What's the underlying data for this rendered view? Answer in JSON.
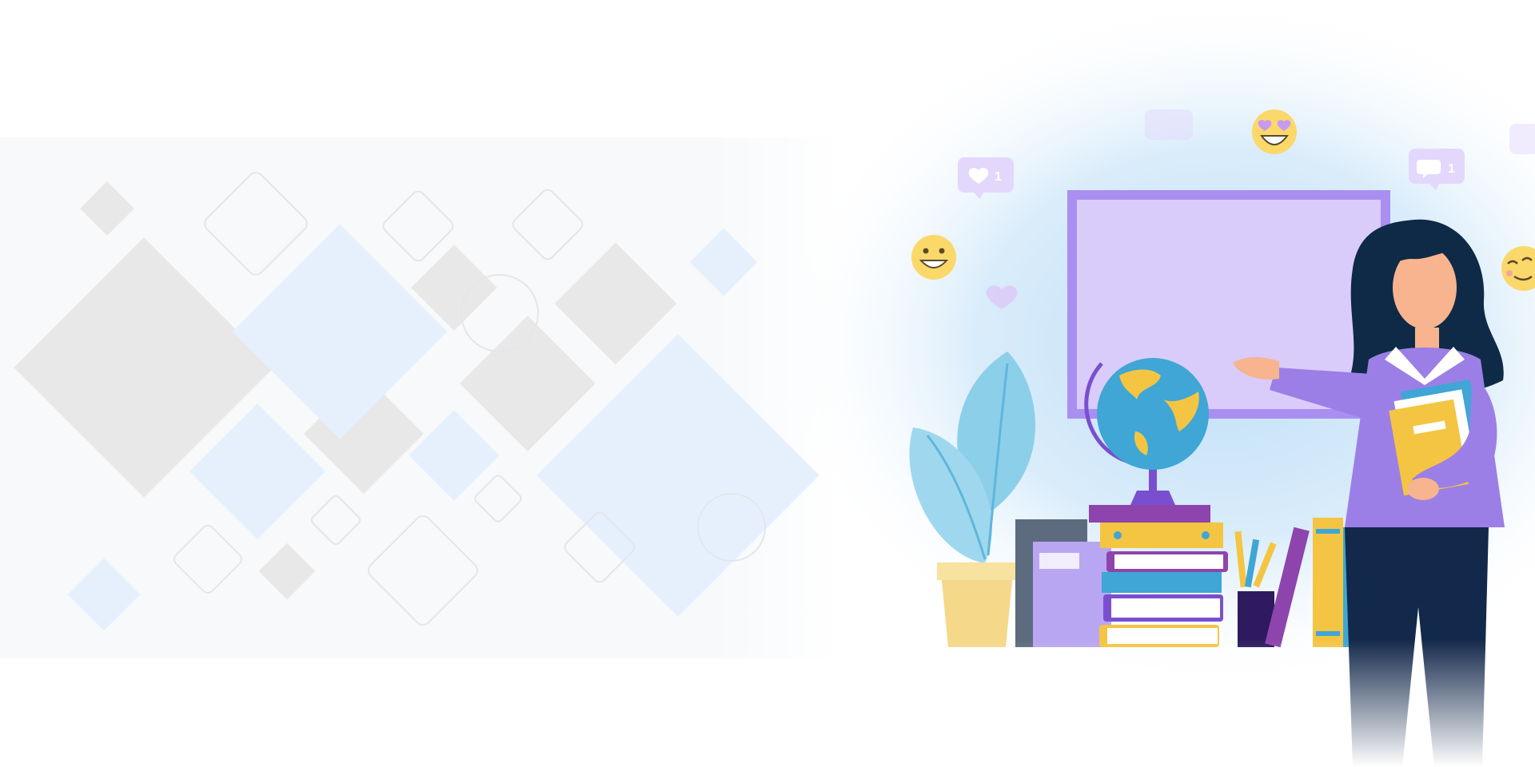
{
  "banner": {
    "reaction_counts": {
      "like": "1",
      "comment": "1"
    },
    "colors": {
      "background": "#ffffff",
      "panel": "#f7f9fb",
      "diamond_gray": "#e8e8e8",
      "diamond_blue": "#e6f0fd",
      "sky_glow": "#bfdff7",
      "board_frame": "#a98ff0",
      "board_fill": "#d9ccfb",
      "teacher_sweater": "#9b7fe6",
      "teacher_pants": "#13294b",
      "teacher_hair": "#0f2a46",
      "skin": "#f7b48e",
      "book_yellow": "#f4c542",
      "ocean": "#3fa6d6",
      "plant_leaf": "#8ccfe9",
      "pot": "#f5d889",
      "emoji_yellow": "#fbd86a"
    },
    "icons": [
      "heart-icon",
      "comment-icon",
      "smile-emoji-icon",
      "heart-eyes-emoji-icon",
      "wink-emoji-icon",
      "globe-icon",
      "plant-icon",
      "books-icon",
      "pencil-cup-icon",
      "teacher-illustration"
    ]
  }
}
